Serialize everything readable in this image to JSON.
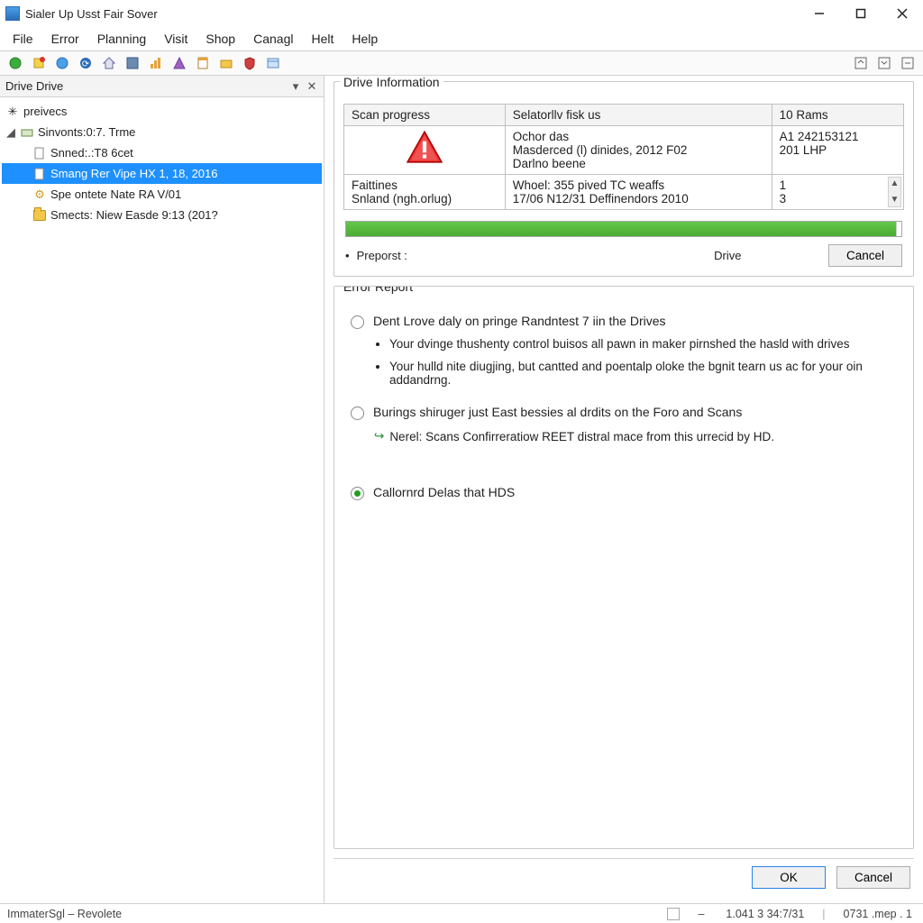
{
  "window": {
    "title": "Sialer Up Usst Fair Sover"
  },
  "menu": {
    "items": [
      "File",
      "Error",
      "Planning",
      "Visit",
      "Shop",
      "Canagl",
      "Helt",
      "Help"
    ]
  },
  "sidebar": {
    "title": "Drive Drive",
    "root": "preivecs",
    "items": [
      {
        "label": "Sinvonts:0:7. Trme"
      },
      {
        "label": "Snned:.:T8 6cet"
      },
      {
        "label": "Smang Rer Vipe HX 1, 18, 2016",
        "selected": true
      },
      {
        "label": "Spe ontete Nate RA V/01"
      },
      {
        "label": "Smects: Niew Easde 9:13 (201?"
      }
    ]
  },
  "drive_info": {
    "legend": "Drive Information",
    "headers": [
      "Scan progress",
      "Selatorllv fisk us",
      "10 Rams"
    ],
    "row1": {
      "c2_lines": [
        "Ochor das",
        "Masderced (l) dinides, 2012 F02",
        "Darlno beene"
      ],
      "c3_lines": [
        "A1 242153121",
        "",
        "201 LHP"
      ]
    },
    "row2": {
      "c1_lines": [
        "Faittines",
        "Snland (ngh.orlug)"
      ],
      "c2_lines": [
        "Whoel: 355 pived TC weaffs",
        "17/06 N12/31 Deffinendors 2010"
      ],
      "c3_lines": [
        "1",
        "3"
      ]
    }
  },
  "progress": {
    "percent": 99,
    "label": "Preporst :",
    "mid": "Drive",
    "cancel": "Cancel"
  },
  "report": {
    "legend": "Error Report",
    "opt1": {
      "label": "Dent Lrove daly on pringe Randntest 7 iin the Drives",
      "bullets": [
        "Your dvinge thushenty control buisos all pawn in maker pirnshed the hasld with drives",
        "Your hulld nite diugjing, but cantted and poentalp oloke the bgnit tearn us ac for your oin addandrng."
      ]
    },
    "opt2": {
      "label": "Burings shiruger just East bessies al drdits on the Foro and Scans",
      "note": "Nerel: Scans Confirreratiow REET distral mace from this urrecid by HD."
    },
    "opt3": {
      "label": "Callornrd Delas that HDS"
    }
  },
  "buttons": {
    "ok": "OK",
    "cancel": "Cancel"
  },
  "status": {
    "left": "ImmaterSgl – Revolete",
    "segs": [
      "–",
      "1.041 3 34:7/31",
      "0731 .mep . 1"
    ]
  }
}
